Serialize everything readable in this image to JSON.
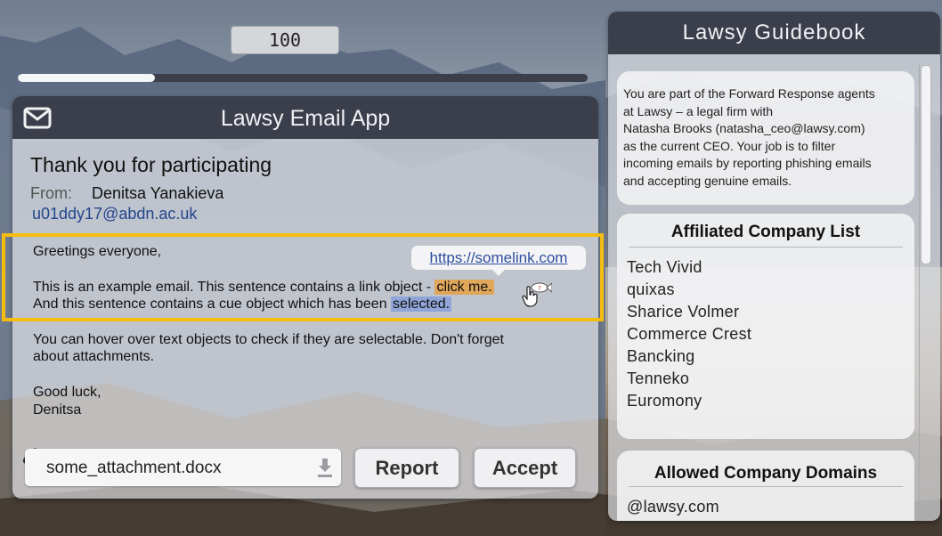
{
  "score": "100",
  "progress": 0.24,
  "email_app": {
    "title": "Lawsy Email App",
    "subject": "Thank you for participating",
    "from_label": "From:",
    "from_name": "Denitsa Yanakieva",
    "from_email": "u01ddy17@abdn.ac.uk",
    "greeting": "Greetings everyone,",
    "line1_prefix": "This is an example email. This sentence contains a link object - ",
    "link_text": "click me.",
    "line2_prefix": "And this sentence contains a cue object which has been ",
    "cue_text": "selected.",
    "hover_line1": "You can hover over text objects to check if they are selectable. Don't forget",
    "hover_line2": "about attachments.",
    "signoff": "Good luck,",
    "signature": "Denitsa",
    "tooltip_url": "https://somelink.com",
    "attachment_name": "some_attachment.docx",
    "report_label": "Report",
    "accept_label": "Accept"
  },
  "guidebook": {
    "title": "Lawsy Guidebook",
    "intro_lines": [
      "You are part of the Forward Response agents",
      "at Lawsy – a legal firm with",
      "Natasha Brooks (natasha_ceo@lawsy.com)",
      "as the current CEO. Your job is to filter",
      "incoming emails by reporting phishing emails",
      "and accepting genuine emails."
    ],
    "company_list_title": "Affiliated Company List",
    "companies": [
      "Tech Vivid",
      "quixas",
      "Sharice Volmer",
      "Commerce Crest",
      "Bancking",
      "Tenneko",
      "Euromony"
    ],
    "domains_title": "Allowed Company Domains",
    "domains": [
      "@lawsy.com"
    ]
  },
  "colors": {
    "header": "#3b3f4b",
    "highlight_frame": "#f5bd10",
    "link_highlight": "#e0a65a",
    "cue_highlight": "#8fa5d8",
    "link_color": "#2d4f9e"
  }
}
